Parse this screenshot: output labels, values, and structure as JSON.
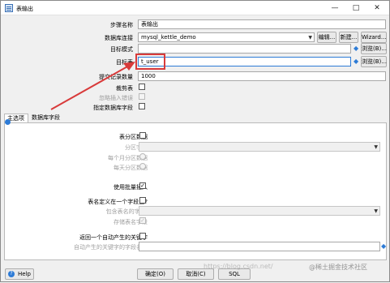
{
  "window": {
    "title": "表输出",
    "minimize": "—",
    "maximize": "□",
    "close": "✕"
  },
  "fields": {
    "step_name": {
      "label": "步骤名称",
      "value": "表输出"
    },
    "db_conn": {
      "label": "数据库连接",
      "value": "mysql_kettle_demo"
    },
    "target_schema": {
      "label": "目标模式",
      "value": ""
    },
    "target_table": {
      "label": "目标表",
      "value": "t_user"
    },
    "commit_size": {
      "label": "提交记录数量",
      "value": "1000"
    },
    "truncate": {
      "label": "裁剪表"
    },
    "ignore_errors": {
      "label": "忽略插入错误"
    },
    "specify_fields": {
      "label": "指定数据库字段"
    }
  },
  "buttons": {
    "edit": "编辑...",
    "new": "新建...",
    "wizard": "Wizard...",
    "browse": "浏览(B)...",
    "ok": "确定(O)",
    "cancel": "取消(C)",
    "sql": "SQL",
    "help": "Help"
  },
  "tabs": [
    {
      "label": "主选项"
    },
    {
      "label": "数据库字段"
    }
  ],
  "main": {
    "partition": "表分区数据",
    "partition_field": "分区字段",
    "monthly": "每个月分区数据",
    "daily": "每天分区数据",
    "batch": "使用批量插入",
    "batch_checked": "✓",
    "tablename_in_field": "表名定义在一个字段里?",
    "tablename_field": "包含表名的字段:",
    "store_tablename": "存储表名字段",
    "store_checked": "✓",
    "return_key": "返回一个自动产生的关键字",
    "key_field": "自动产生的关键字的字段名称"
  },
  "watermark": {
    "text": "https://blog.csdn.net/",
    "brand": "@稀土掘金技术社区"
  },
  "colors": {
    "highlight": "#d83a3a",
    "accent": "#2d7bd6"
  }
}
